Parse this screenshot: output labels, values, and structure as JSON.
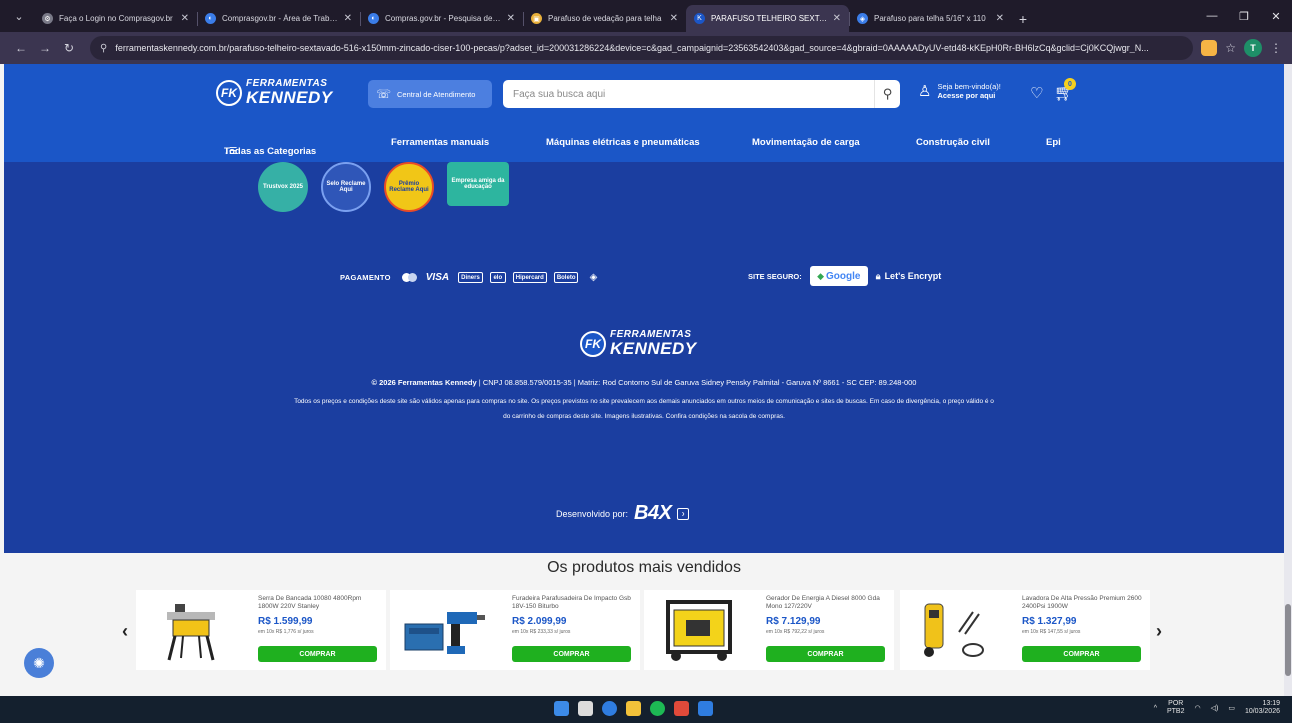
{
  "browser": {
    "tabs": [
      {
        "title": "Faça o Login no Comprasgov.br",
        "favicon_color": "#7a7a88",
        "favicon": "gear-icon",
        "active": false
      },
      {
        "title": "Comprasgov.br - Área de Trabalho",
        "favicon_color": "#3b7de8",
        "favicon": "globe-icon",
        "active": false
      },
      {
        "title": "Compras.gov.br - Pesquisa de Preços",
        "favicon_color": "#3b7de8",
        "favicon": "globe-icon",
        "active": false
      },
      {
        "title": "Parafuso de vedação para telha",
        "favicon_color": "#e8b03b",
        "favicon": "shop-icon",
        "active": false
      },
      {
        "title": "PARAFUSO TELHEIRO SEXTAVADO",
        "favicon_color": "#1b56c7",
        "favicon": "kennedy-icon",
        "active": true
      },
      {
        "title": "Parafuso para telha 5/16\" x 110",
        "favicon_color": "#3b7de8",
        "favicon": "shop-icon",
        "active": false
      }
    ],
    "new_tab": "+",
    "url": "ferramentaskennedy.com.br/parafuso-telheiro-sextavado-516-x150mm-zincado-ciser-100-pecas/p?adset_id=200031286224&device=c&gad_campaignid=23563542403&gad_source=4&gbraid=0AAAAADyUV-etd48-kKEpH0Rr-BH6lzCq&gclid=Cj0KCQjwgr_N...",
    "profile_initial": "T"
  },
  "header": {
    "logo_top": "FERRAMENTAS",
    "logo_bottom": "KENNEDY",
    "attendance_label": "Central de Atendimento",
    "search_placeholder": "Faça sua busca aqui",
    "account_line1": "Seja bem-vindo(a)!",
    "account_line2": "Acesse por aqui",
    "cart_count": "0"
  },
  "categories": {
    "all": "Todas as Categorias",
    "items": [
      "Ferramentas manuais",
      "Máquinas elétricas e pneumáticas",
      "Movimentação de carga",
      "Construção civil",
      "Epi"
    ]
  },
  "footer": {
    "seals": [
      "Trustvox 2025",
      "Selo Reclame Aqui",
      "Prêmio Reclame Aqui",
      "Empresa amiga da educação"
    ],
    "payment_label": "PAGAMENTO",
    "payment_cards": [
      "VISA",
      "Diners",
      "elo",
      "Hipercard",
      "Boleto",
      "Pix"
    ],
    "secure_label": "SITE SEGURO:",
    "google_label": "Google",
    "encrypt_label": "Let's Encrypt",
    "copyright": "© 2026 Ferramentas Kennedy",
    "company_info": "| CNPJ 08.858.579/0015-35 | Matriz: Rod Contorno Sul de Garuva Sidney Pensky Palmital - Garuva Nº 8661 - SC CEP: 89.248-000",
    "legal_line1": "Todos os preços e condições deste site são válidos apenas para compras no site. Os preços previstos no site prevalecem aos demais anunciados em outros meios de comunicação e sites de buscas. Em caso de divergência, o preço válido é o",
    "legal_line2": "do carrinho de compras deste site. Imagens ilustrativas. Confira condições na sacola de compras.",
    "developed_by": "Desenvolvido por:",
    "dev_brand": "B4X"
  },
  "bestsellers": {
    "title": "Os produtos mais vendidos",
    "buy_label": "COMPRAR",
    "products": [
      {
        "name": "Serra De Bancada 10080 4800Rpm 1800W 220V Stanley",
        "price": "R$ 1.599,99",
        "installments": "em 10x R$ 1,776 s/ juros"
      },
      {
        "name": "Furadeira Parafusadeira De Impacto Gsb 18V-150 Biturbo",
        "price": "R$ 2.099,99",
        "installments": "em 10x R$ 233,33 s/ juros"
      },
      {
        "name": "Gerador De Energia A Diesel 8000 Gda Mono 127/220V",
        "price": "R$ 7.129,99",
        "installments": "em 10x R$ 792,22 s/ juros"
      },
      {
        "name": "Lavadora De Alta Pressão Premium 2600 2400Psi 1900W",
        "price": "R$ 1.327,99",
        "installments": "em 10x R$ 147,55 s/ juros"
      }
    ]
  },
  "taskbar": {
    "lang_line1": "POR",
    "lang_line2": "PTB2",
    "time": "13:19",
    "date": "10/03/2026"
  }
}
